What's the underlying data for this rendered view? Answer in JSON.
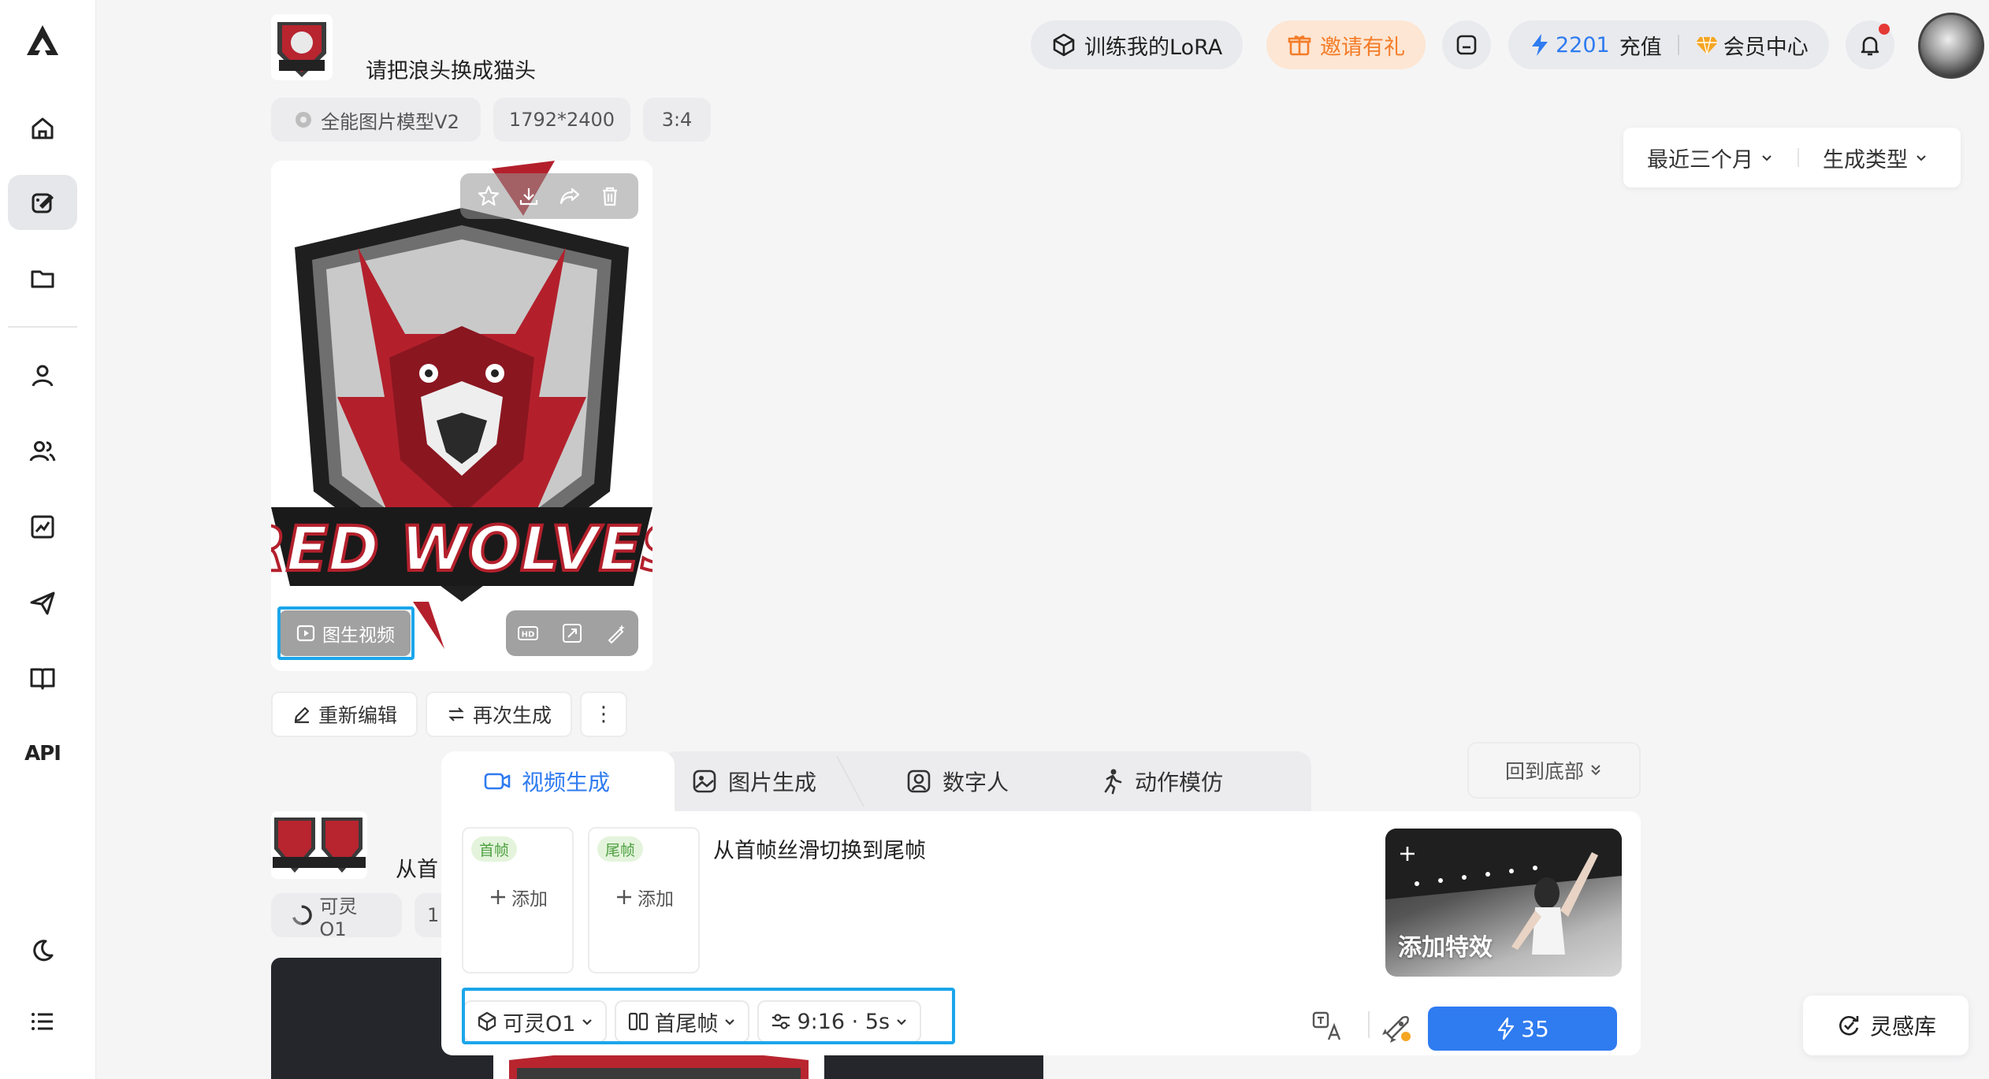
{
  "sidebar": {
    "api_label": "API"
  },
  "header": {
    "lora_button": "训练我的LoRA",
    "invite_button": "邀请有礼",
    "credits": "2201",
    "recharge": "充值",
    "vip_center": "会员中心"
  },
  "filters": {
    "time_range": "最近三个月",
    "gen_type": "生成类型"
  },
  "task1": {
    "prompt": "请把浪头换成猫头",
    "model_chip": "全能图片模型V2",
    "size_chip": "1792*2400",
    "ratio_chip": "3:4",
    "image_text": "RED WOLVES",
    "i2v_button": "图生视频",
    "reedit_button": "重新编辑",
    "regenerate_button": "再次生成",
    "more_button": "⋮"
  },
  "task2": {
    "prompt_partial": "从首",
    "model_chip": "可灵O1",
    "chip2_partial": "1"
  },
  "back_to_bottom": "回到底部",
  "composer": {
    "tabs": [
      "视频生成",
      "图片生成",
      "数字人",
      "动作模仿"
    ],
    "first_frame_tag": "首帧",
    "last_frame_tag": "尾帧",
    "add_label": "添加",
    "prompt": "从首帧丝滑切换到尾帧",
    "effect_label": "添加特效",
    "model_select": "可灵O1",
    "mode_select": "首尾帧",
    "params_select": "9:16 · 5s",
    "generate_cost": "35"
  },
  "inspiration_button": "灵感库",
  "colors": {
    "accent": "#2f7bf0",
    "highlight": "#1ba6ea",
    "invite": "#f47c28",
    "credit": "#2f7bf0",
    "vip": "#f5a623",
    "notify": "#e53935"
  }
}
